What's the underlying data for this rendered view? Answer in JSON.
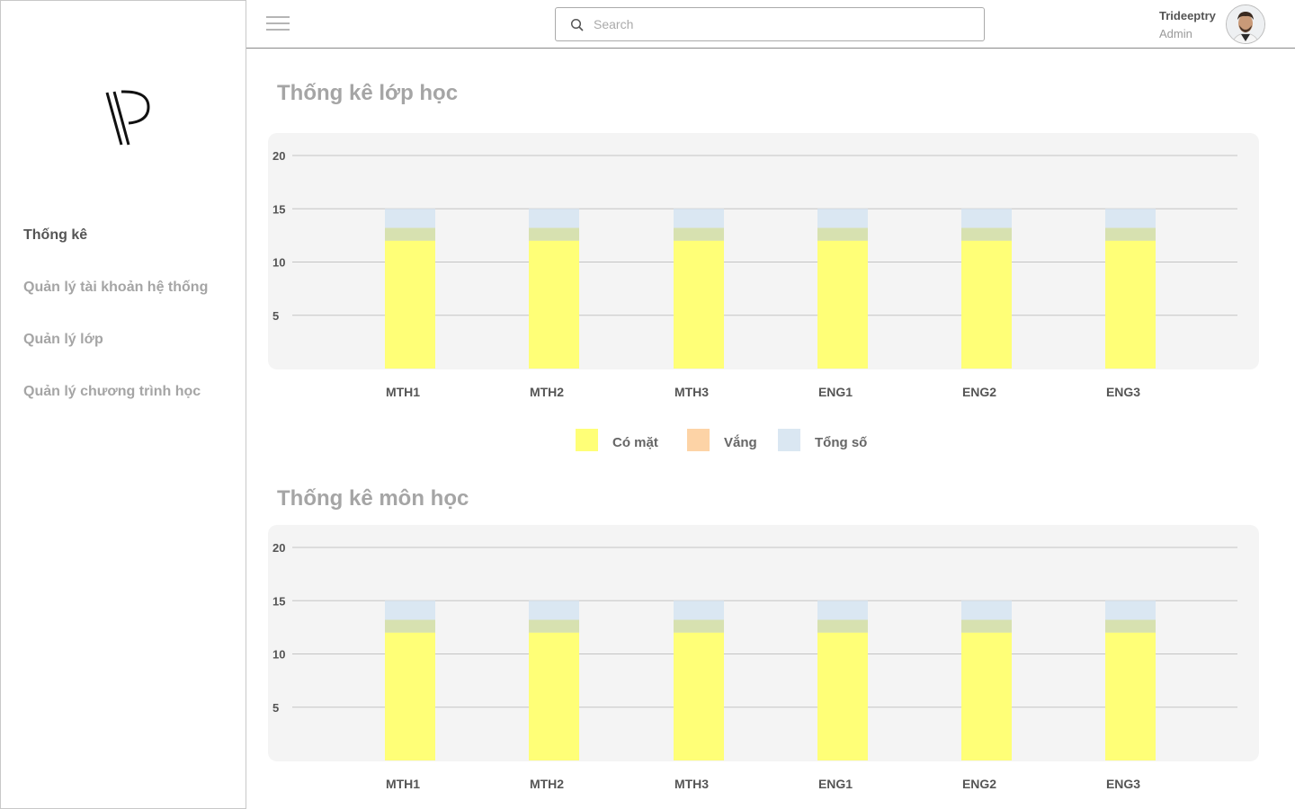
{
  "sidebar": {
    "logo": "logo-mark",
    "items": [
      {
        "label": "Thống kê",
        "active": true
      },
      {
        "label": "Quản lý tài khoản hệ thống",
        "active": false
      },
      {
        "label": "Quản lý lớp",
        "active": false
      },
      {
        "label": "Quản lý chương trình học",
        "active": false
      }
    ]
  },
  "header": {
    "menu_icon": "hamburger-icon",
    "search": {
      "placeholder": "Search",
      "value": "",
      "icon": "search-icon"
    },
    "user": {
      "name": "Trideeptry",
      "role": "Admin",
      "avatar": "avatar"
    }
  },
  "colors": {
    "present": "#ffff77",
    "absent": "#fdd3a6",
    "total": "#dae7f2"
  },
  "main": {
    "class_stats": {
      "title": "Thống kê lớp học"
    },
    "subject_stats": {
      "title": "Thống kê môn học"
    },
    "legend": [
      {
        "label": "Có mặt",
        "color": "#ffff77"
      },
      {
        "label": "Vắng",
        "color": "#fdd3a6"
      },
      {
        "label": "Tổng số",
        "color": "#dae7f2"
      }
    ]
  },
  "chart_data": [
    {
      "type": "bar",
      "title": "Thống kê lớp học",
      "categories": [
        "MTH1",
        "MTH2",
        "MTH3",
        "ENG1",
        "ENG2",
        "ENG3"
      ],
      "series": [
        {
          "name": "Có mặt",
          "values": [
            12,
            12,
            12,
            12,
            12,
            12
          ]
        },
        {
          "name": "Vắng",
          "values": [
            1.2,
            1.2,
            1.2,
            1.2,
            1.2,
            1.2
          ]
        },
        {
          "name": "Tổng số",
          "values": [
            15,
            15,
            15,
            15,
            15,
            15
          ]
        }
      ],
      "yticks": [
        "5",
        "10",
        "15",
        "20"
      ],
      "ylim": [
        0,
        20
      ],
      "grid": true,
      "legend": "bottom-center"
    },
    {
      "type": "bar",
      "title": "Thống kê môn học",
      "categories": [
        "MTH1",
        "MTH2",
        "MTH3",
        "ENG1",
        "ENG2",
        "ENG3"
      ],
      "series": [
        {
          "name": "Có mặt",
          "values": [
            12,
            12,
            12,
            12,
            12,
            12
          ]
        },
        {
          "name": "Vắng",
          "values": [
            1.2,
            1.2,
            1.2,
            1.2,
            1.2,
            1.2
          ]
        },
        {
          "name": "Tổng số",
          "values": [
            15,
            15,
            15,
            15,
            15,
            15
          ]
        }
      ],
      "yticks": [
        "5",
        "10",
        "15",
        "20"
      ],
      "ylim": [
        0,
        20
      ],
      "grid": true,
      "legend": "none"
    }
  ]
}
